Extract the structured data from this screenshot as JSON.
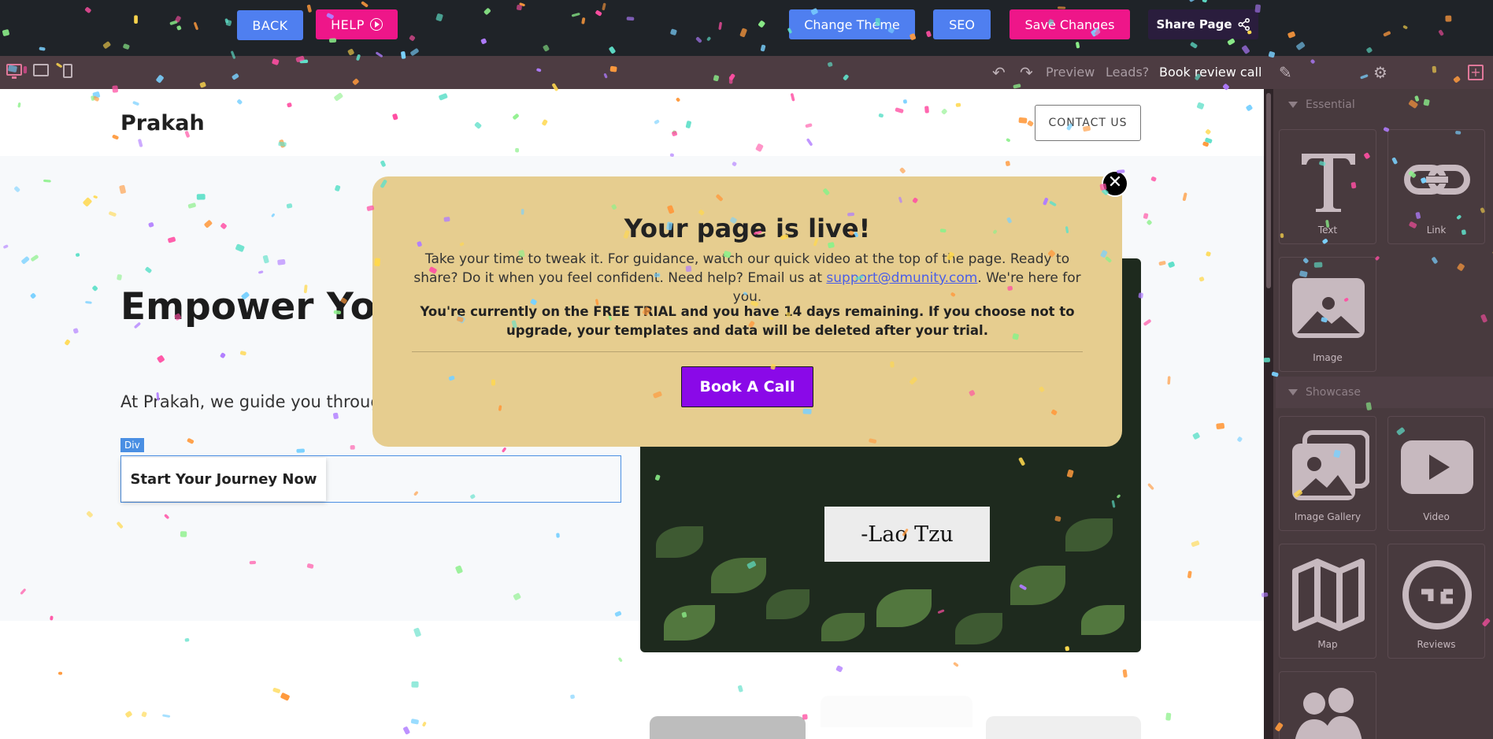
{
  "topbar": {
    "back_label": "BACK",
    "help_label": "HELP",
    "change_theme_label": "Change Theme",
    "seo_label": "SEO",
    "save_label": "Save Changes",
    "share_label": "Share Page"
  },
  "toolbar": {
    "preview_label": "Preview",
    "leads_label": "Leads?",
    "book_review_label": "Book review call"
  },
  "site": {
    "logo": "Prakah",
    "contact_label": "CONTACT US",
    "hero_title": "Empower Your Success With E",
    "hero_text": "At Prakah, we guide you through your goals, making the path clea",
    "div_tag": "Div",
    "cta_label": "Start Your Journey Now",
    "quote_signature": "-Lao Tzu"
  },
  "modal": {
    "title": "Your page is live!",
    "guide_text_before": "Take your time to tweak it. For guidance, watch our quick video at the top of the page. Ready to share? Do it when you feel confident. Need help? Email us at ",
    "email": "support@dmunity.com",
    "guide_text_after": ". We're here for you.",
    "trial_text": "You're currently on the FREE TRIAL and you have 14 days remaining. If you choose not to upgrade, your templates and data will be deleted after your trial.",
    "button_label": "Book A Call"
  },
  "panel": {
    "essential_label": "Essential",
    "showcase_label": "Showcase",
    "cards": {
      "text": "Text",
      "link": "Link",
      "image": "Image",
      "gallery": "Image Gallery",
      "video": "Video",
      "map": "Map",
      "reviews": "Reviews"
    }
  },
  "colors": {
    "topbar_bg": "#1f2328",
    "blue_button": "#4f7ff0",
    "pink_button": "#ee1689",
    "share_button": "#2a1d3d",
    "modal_bg": "#e6cd8f",
    "modal_cta": "#8a09e8",
    "panel_bg": "#483a3e"
  }
}
